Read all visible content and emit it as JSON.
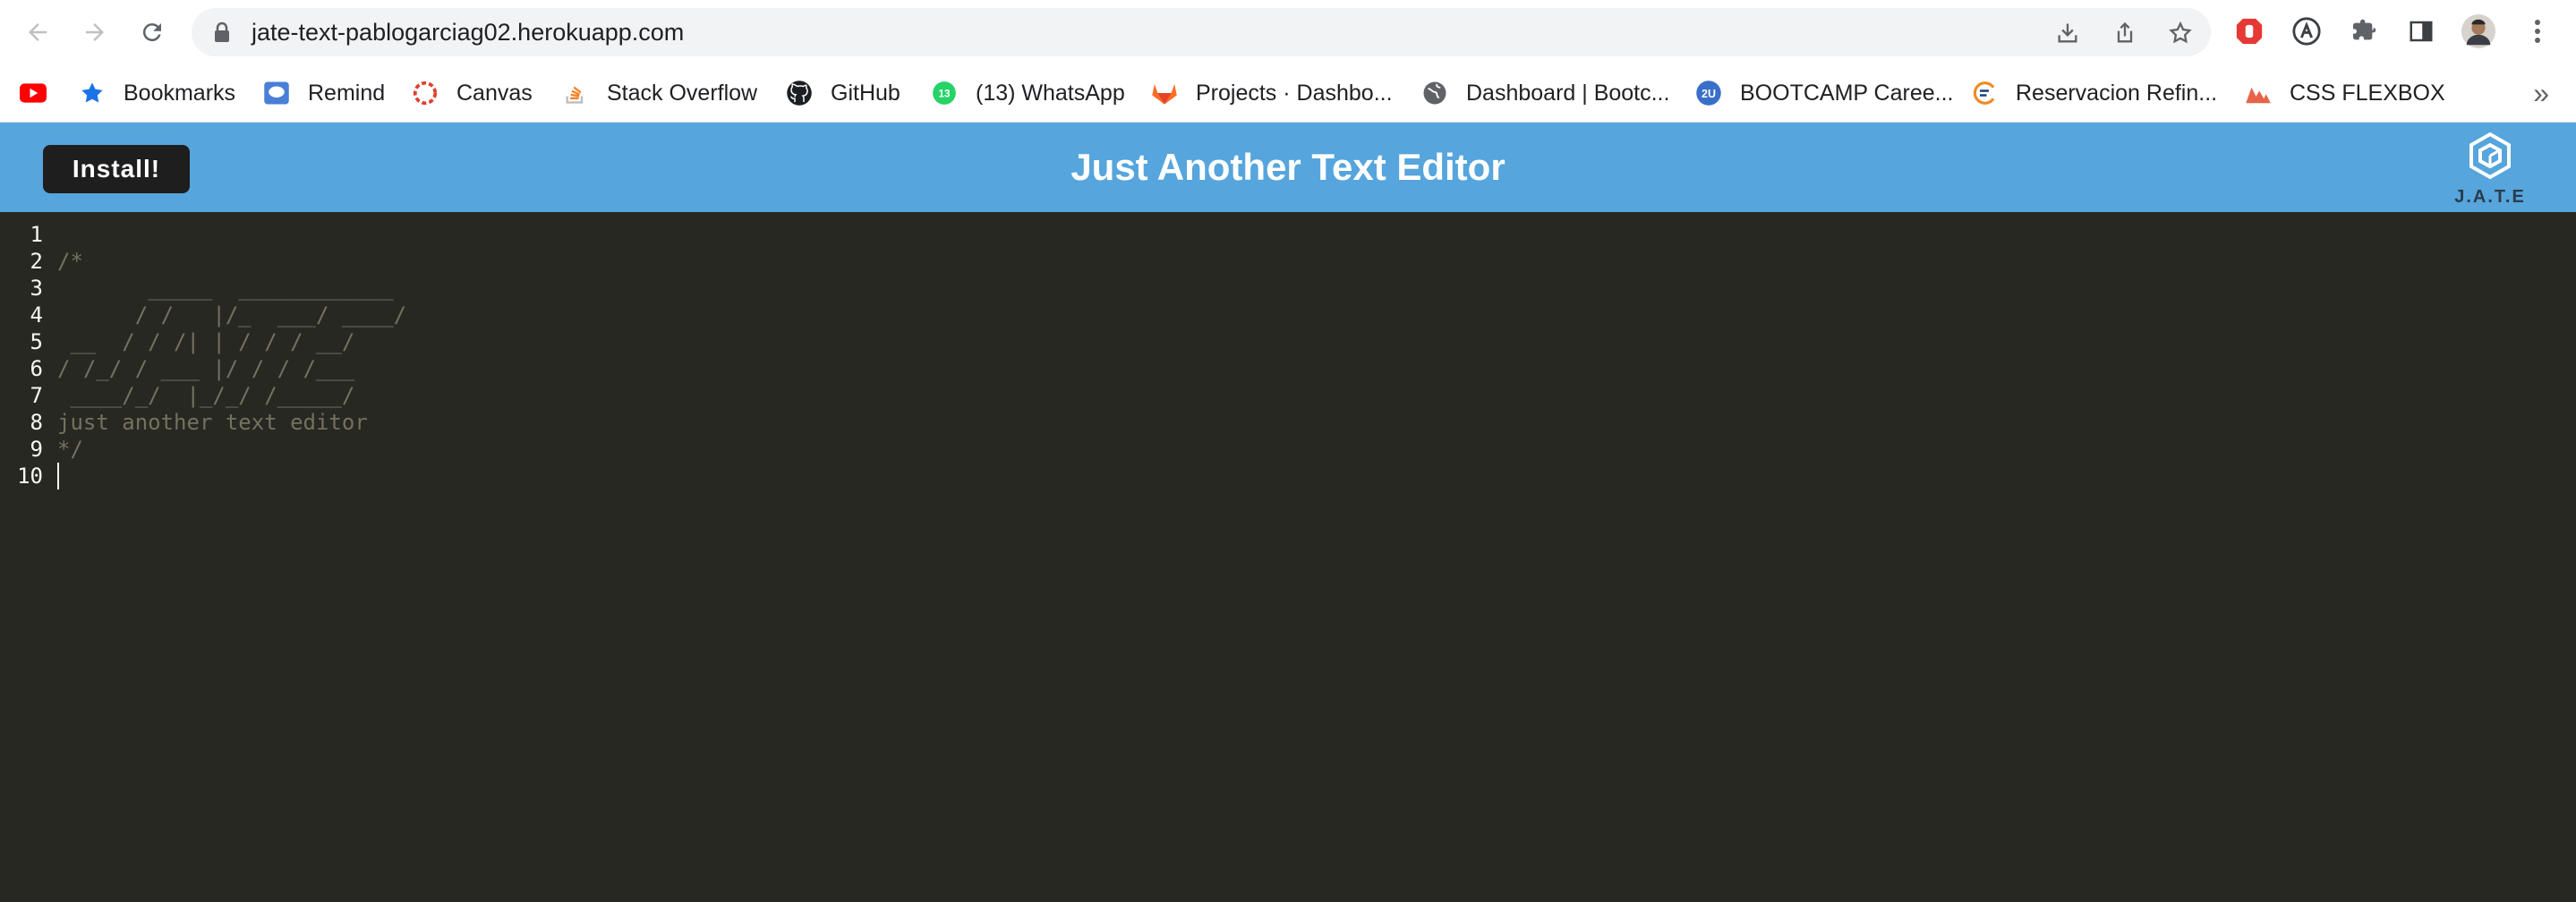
{
  "browser": {
    "url": "jate-text-pablogarciag02.herokuapp.com",
    "bookmarks": [
      {
        "label": "",
        "icon": "youtube-icon"
      },
      {
        "label": "Bookmarks",
        "icon": "star-icon"
      },
      {
        "label": "Remind",
        "icon": "remind-icon"
      },
      {
        "label": "Canvas",
        "icon": "canvas-icon"
      },
      {
        "label": "Stack Overflow",
        "icon": "stackoverflow-icon"
      },
      {
        "label": "GitHub",
        "icon": "github-icon"
      },
      {
        "label": "(13) WhatsApp",
        "icon": "whatsapp-icon"
      },
      {
        "label": "Projects · Dashbo...",
        "icon": "gitlab-icon"
      },
      {
        "label": "Dashboard | Bootc...",
        "icon": "globe-icon"
      },
      {
        "label": "BOOTCAMP Caree...",
        "icon": "2u-icon"
      },
      {
        "label": "Reservacion Refin...",
        "icon": "reservacion-icon"
      },
      {
        "label": "CSS FLEXBOX",
        "icon": "cssflexbox-icon"
      }
    ],
    "more_label": "»",
    "whatsapp_badge": "13"
  },
  "app": {
    "title": "Just Another Text Editor",
    "install_label": "Install!",
    "logo_text": "J.A.T.E"
  },
  "editor": {
    "line_numbers": [
      "1",
      "2",
      "3",
      "4",
      "5",
      "6",
      "7",
      "8",
      "9",
      "10"
    ],
    "lines": [
      "",
      "/*",
      "       _____  ____________",
      "      / /   |/_  ___/ ____/",
      " __  / / /| | / / / __/",
      "/ /_/ / ___ |/ / / /___",
      " ____/_/  |_/_/ /_____/",
      "just another text editor",
      "*/",
      ""
    ]
  },
  "colors": {
    "header_bg": "#56a5dd",
    "editor_bg": "#272822",
    "comment": "#75715e"
  }
}
